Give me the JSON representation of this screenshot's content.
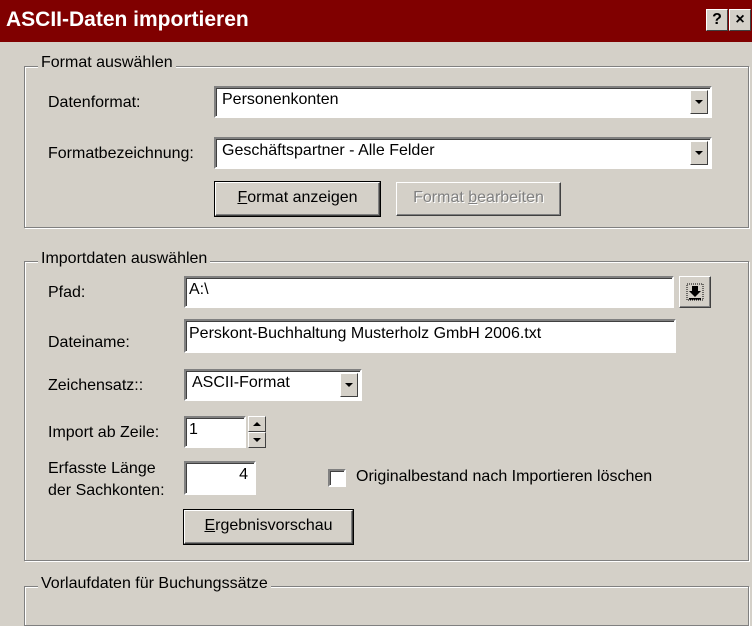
{
  "window": {
    "title": "ASCII-Daten importieren",
    "help_label": "?",
    "close_label": "×"
  },
  "format_group": {
    "legend": "Format auswählen",
    "datenformat_label": "Datenformat:",
    "datenformat_value": "Personenkonten",
    "bezeichnung_label": "Formatbezeichnung:",
    "bezeichnung_value": "Geschäftspartner - Alle Felder",
    "show_first": "F",
    "show_rest": "ormat anzeigen",
    "edit_first": "Format ",
    "edit_acc": "b",
    "edit_rest": "earbeiten"
  },
  "import_group": {
    "legend": "Importdaten auswählen",
    "pfad_label": "Pfad:",
    "pfad_value": "A:\\",
    "dateiname_label": "Dateiname:",
    "dateiname_value": "Perskont-Buchhaltung Musterholz GmbH 2006.txt",
    "zeichensatz_label": "Zeichensatz::",
    "zeichensatz_value": "ASCII-Format",
    "zeile_label": "Import ab Zeile:",
    "zeile_value": "1",
    "laenge_label_1": "Erfasste Länge",
    "laenge_label_2": "der Sachkonten:",
    "laenge_value": "4",
    "delete_checkbox_label": "Originalbestand nach Importieren löschen",
    "delete_checked": false,
    "preview_first": "E",
    "preview_rest": "rgebnisvorschau"
  },
  "vorlauf_group": {
    "legend": "Vorlaufdaten für Buchungssätze"
  }
}
